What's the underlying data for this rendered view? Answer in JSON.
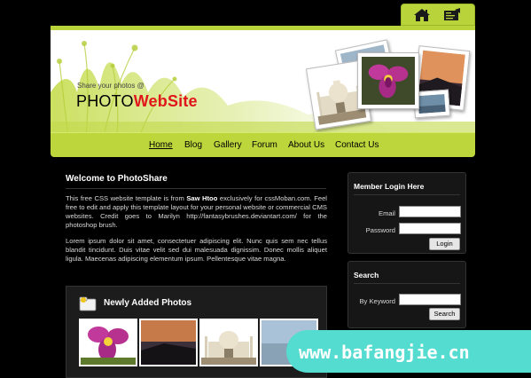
{
  "header": {
    "tagline": "Share your photos @",
    "logo_part1": "PHOTO",
    "logo_part2": "WebSite",
    "top_icons": [
      "home-icon",
      "mail-icon"
    ]
  },
  "nav": {
    "items": [
      "Home",
      "Blog",
      "Gallery",
      "Forum",
      "About Us",
      "Contact Us"
    ],
    "active": "Home"
  },
  "main": {
    "heading": "Welcome to PhotoShare",
    "para1_pre": "This free CSS website template is from ",
    "para1_author": "Saw Htoo",
    "para1_post": " exclusively for cssMoban.com. Feel free to edit and apply this template layout for your personal website or commercial CMS websites. Credit goes to Marilyn http://fantasybrushes.deviantart.com/ for the photoshop brush.",
    "para2": "Lorem ipsum dolor sit amet, consectetuer adipiscing elit. Nunc quis sem nec tellus blandit tincidunt. Duis vitae velit sed dui malesuada dignissim. Donec mollis aliquet ligula. Maecenas adipiscing elementum ipsum. Pellentesque vitae magna.",
    "new_photos_title": "Newly Added Photos"
  },
  "sidebar": {
    "login": {
      "title": "Member Login Here",
      "email_label": "Email",
      "password_label": "Password",
      "button": "Login"
    },
    "search": {
      "title": "Search",
      "keyword_label": "By Keyword",
      "button": "Search"
    }
  },
  "watermark": "www.bafangjie.cn",
  "colors": {
    "accent_green": "#bcd63c",
    "logo_red": "#e0161c",
    "background": "#000000",
    "watermark": "#55dcd0"
  }
}
